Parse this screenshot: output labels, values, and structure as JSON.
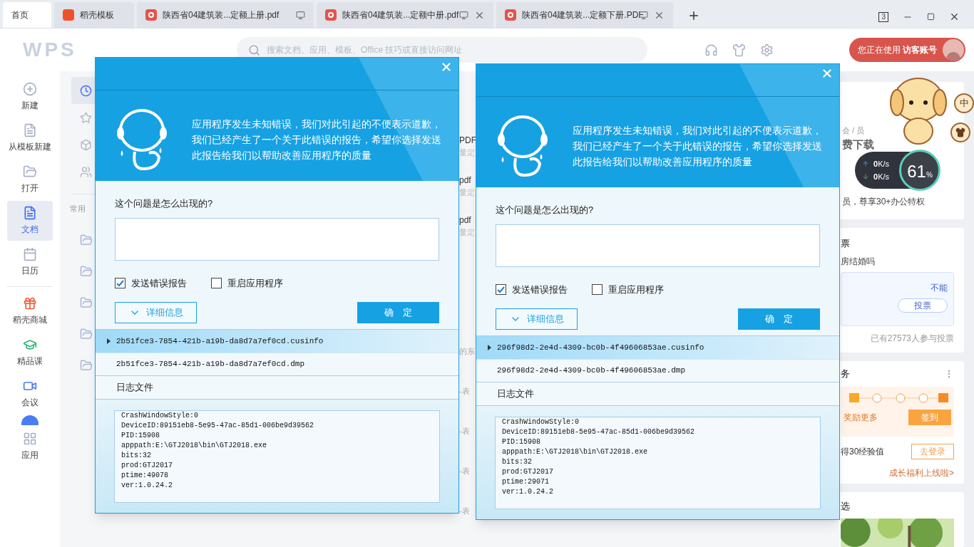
{
  "tabs": [
    {
      "label": "首页",
      "kind": "home",
      "selected": true,
      "closable": false,
      "monitor": false
    },
    {
      "label": "稻壳模板",
      "kind": "docer",
      "selected": false,
      "closable": false,
      "monitor": false
    },
    {
      "label": "陕西省04建筑装...定额上册.pdf",
      "kind": "pdf",
      "selected": false,
      "closable": false,
      "monitor": true
    },
    {
      "label": "陕西省04建筑装...定额中册.pdf",
      "kind": "pdf",
      "selected": false,
      "closable": true,
      "monitor": true
    },
    {
      "label": "陕西省04建筑装...定额下册.PDF",
      "kind": "pdf",
      "selected": false,
      "closable": true,
      "monitor": true
    }
  ],
  "window_badge": "3",
  "header": {
    "logo": "WPS",
    "search_placeholder": "搜索文档、应用、模板、Office 技巧或直接访问网址",
    "account": "您正在使用 **访客账号**"
  },
  "sidebar": [
    {
      "label": "新建",
      "selected": false
    },
    {
      "label": "从模板新建",
      "selected": false
    },
    {
      "label": "打开",
      "selected": false
    },
    {
      "label": "文档",
      "selected": true
    },
    {
      "label": "日历",
      "selected": false
    },
    {
      "label": "稻壳商城",
      "selected": false
    },
    {
      "label": "精品课",
      "selected": false
    },
    {
      "label": "会议",
      "selected": false
    },
    {
      "label": "应用",
      "selected": false
    }
  ],
  "nav_items": [
    {
      "selected": true
    },
    {
      "selected": false
    },
    {
      "selected": false
    },
    {
      "selected": false
    }
  ],
  "nav_section_label": "常用",
  "list_fragments": [
    {
      "title": "PDF",
      "sub": "量定"
    },
    {
      "title": "pdf",
      "sub": "量定"
    },
    {
      "title": "pdf",
      "sub": "量定"
    }
  ],
  "row_fragments": [
    "的东",
    "-表",
    "-表",
    "-表",
    "-表"
  ],
  "dialogs": [
    {
      "message": "应用程序发生未知错误，我们对此引起的不便表示道歉，我们已经产生了一个关于此错误的报告，希望你选择发送此报告给我们以帮助改善应用程序的质量",
      "question": "这个问题是怎么出现的?",
      "options": [
        {
          "label": "发送错误报告",
          "checked": true
        },
        {
          "label": "重启应用程序",
          "checked": false
        }
      ],
      "details_button": "详细信息",
      "ok_button": "确　定",
      "files": [
        {
          "name": "2b51fce3-7854-421b-a19b-da8d7a7ef0cd.cusinfo",
          "selected": true
        },
        {
          "name": "2b51fce3-7854-421b-a19b-da8d7a7ef0cd.dmp",
          "selected": false
        }
      ],
      "log_label": "日志文件",
      "log_lines": [
        "CrashWindowStyle:0",
        "DeviceID:89151eb8-5e95-47ac-85d1-006be9d39562",
        "PID:15908",
        "apppath:E:\\GTJ2018\\bin\\GTJ2018.exe",
        "bits:32",
        "prod:GTJ2017",
        "ptime:49078",
        "ver:1.0.24.2"
      ]
    },
    {
      "message": "应用程序发生未知错误，我们对此引起的不便表示道歉，我们已经产生了一个关于此错误的报告，希望你选择发送此报告给我们以帮助改善应用程序的质量",
      "question": "这个问题是怎么出现的?",
      "options": [
        {
          "label": "发送错误报告",
          "checked": true
        },
        {
          "label": "重启应用程序",
          "checked": false
        }
      ],
      "details_button": "详细信息",
      "ok_button": "确　定",
      "files": [
        {
          "name": "296f98d2-2e4d-4309-bc0b-4f49606853ae.cusinfo",
          "selected": true
        },
        {
          "name": "296f98d2-2e4d-4309-bc0b-4f49606853ae.dmp",
          "selected": false
        }
      ],
      "log_label": "日志文件",
      "log_lines": [
        "CrashWindowStyle:0",
        "DeviceID:89151eb8-5e95-47ac-85d1-006be9d39562",
        "PID:15908",
        "apppath:E:\\GTJ2018\\bin\\GTJ2018.exe",
        "bits:32",
        "prod:GTJ2017",
        "ptime:29071",
        "ver:1.0.24.2"
      ]
    }
  ],
  "right_panel": {
    "member_card": {
      "tag": "会 / 员",
      "headline": "费下载",
      "caption": "员，尊享30+办公特权"
    },
    "vote_card": {
      "title": "票",
      "question": "房结婚吗",
      "answer": "不能",
      "vote_button": "投票",
      "count": "已有27573人参与投票"
    },
    "task_card": {
      "title": "务",
      "reward": "奖励更多",
      "checkin_button": "签到",
      "exp": "得30经验值",
      "login_button": "去登录",
      "link": "成长福利上线啦>"
    },
    "pick_card": {
      "title": "选"
    }
  },
  "speed_meter": {
    "up": "**0**K/s",
    "down": "**0**K/s",
    "percent": "61",
    "unit": "%"
  },
  "float_badges": [
    "中"
  ]
}
